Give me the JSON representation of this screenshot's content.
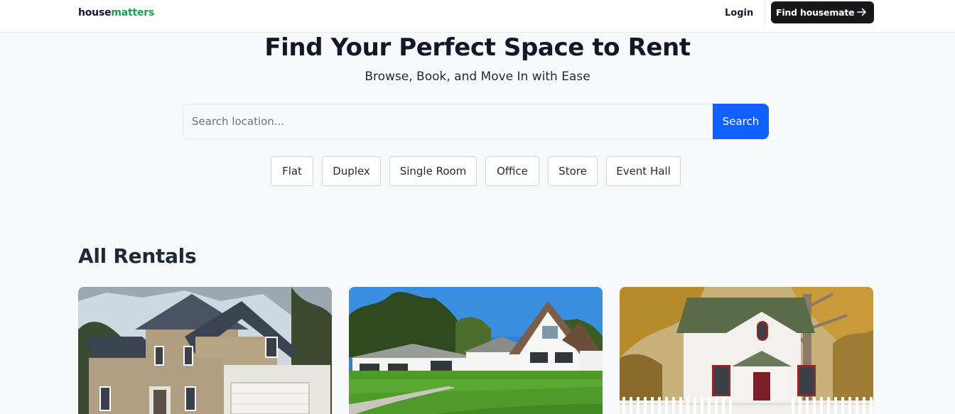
{
  "nav": {
    "logo_part1": "house",
    "logo_part2": "matters",
    "login_label": "Login",
    "cta_label": "Find housemate",
    "cta_icon": "arrow-right-icon"
  },
  "hero": {
    "title": "Find Your Perfect Space to Rent",
    "subtitle": "Browse, Book, and Move In with Ease"
  },
  "search": {
    "placeholder": "Search location...",
    "value": "",
    "button_label": "Search"
  },
  "categories": [
    "Flat",
    "Duplex",
    "Single Room",
    "Office",
    "Store",
    "Event Hall"
  ],
  "rentals": {
    "title": "All Rentals"
  },
  "colors": {
    "brand_green": "#16a34a",
    "primary_blue": "#1062fe",
    "dark_button": "#18181b",
    "page_bg": "#f8f9fb"
  }
}
